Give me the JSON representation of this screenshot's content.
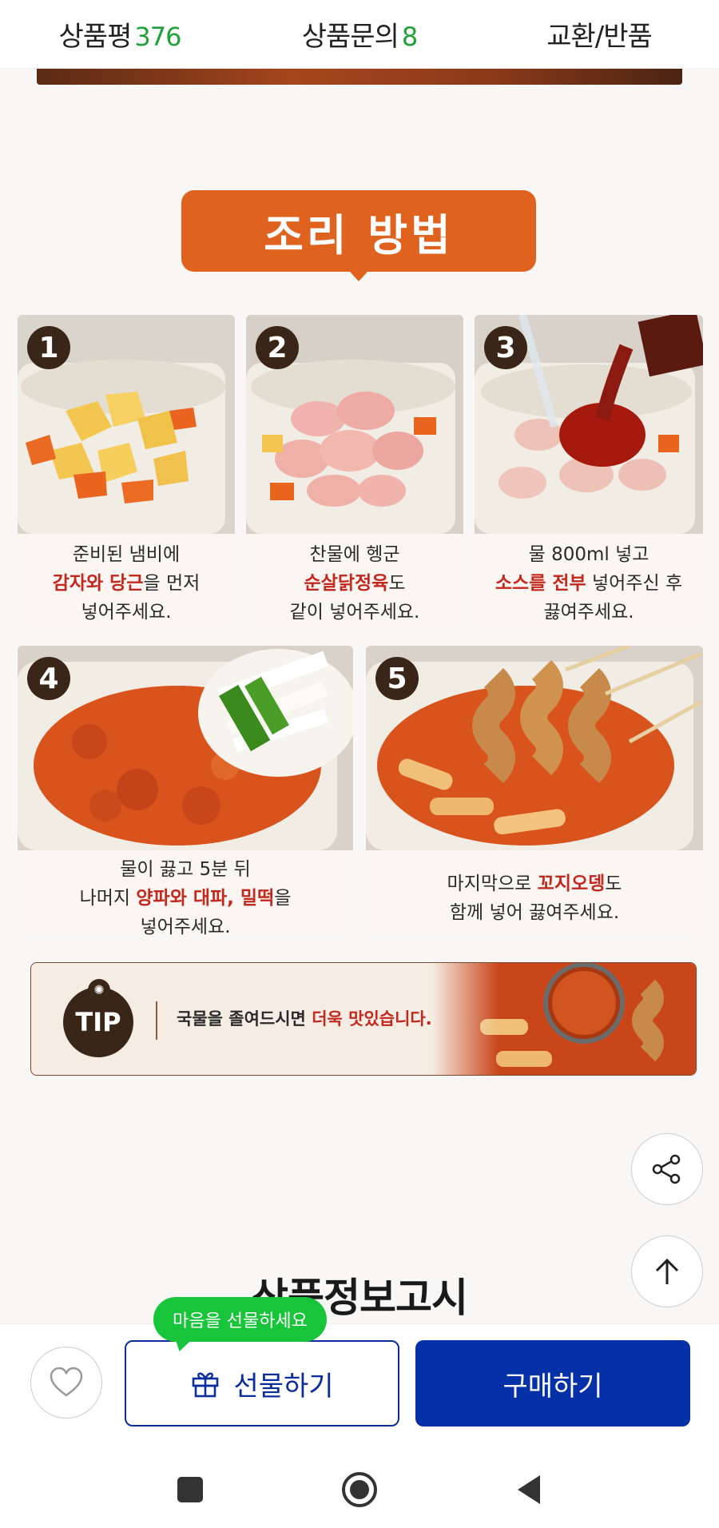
{
  "tabs": [
    {
      "label": "상품평",
      "count": "376"
    },
    {
      "label": "상품문의",
      "count": "8"
    },
    {
      "label": "교환/반품",
      "count": ""
    }
  ],
  "section_title": "조리 방법",
  "steps": [
    {
      "number": "1",
      "line1": "준비된 냄비에",
      "line2_hl": "감자와 당근",
      "line2_rest": "을 먼저",
      "line3": "넣어주세요."
    },
    {
      "number": "2",
      "line1": "찬물에 헹군",
      "line2_hl": "순살닭정육",
      "line2_rest": "도",
      "line3": "같이 넣어주세요."
    },
    {
      "number": "3",
      "line1": "물 800ml 넣고",
      "line2_hl": "소스를 전부",
      "line2_rest": " 넣어주신 후",
      "line3": "끓여주세요."
    },
    {
      "number": "4",
      "line1": "물이 끓고 5분 뒤",
      "line2_pre": "나머지 ",
      "line2_hl": "양파와 대파, 밀떡",
      "line2_rest": "을",
      "line3": "넣어주세요."
    },
    {
      "number": "5",
      "line1_pre": "마지막으로 ",
      "line1_hl": "꼬지오뎅",
      "line1_rest": "도",
      "line2": "함께 넣어 끓여주세요."
    }
  ],
  "tip": {
    "badge": "TIP",
    "text": "국물을 졸여드시면 ",
    "text_hl": "더욱 맛있습니다."
  },
  "product_info_title": "상품정보고시",
  "bottom_bar": {
    "bubble": "마음을 선물하세요",
    "gift_label": "선물하기",
    "buy_label": "구매하기"
  },
  "colors": {
    "accent_orange": "#e0621f",
    "highlight_red": "#c2281d",
    "buy_blue": "#0430a8",
    "bubble_green": "#18c43a",
    "count_green": "#22a03a"
  },
  "icons": [
    "share-icon",
    "arrow-up-icon",
    "heart-icon",
    "gift-icon",
    "nav-recents-icon",
    "nav-home-icon",
    "nav-back-icon"
  ]
}
